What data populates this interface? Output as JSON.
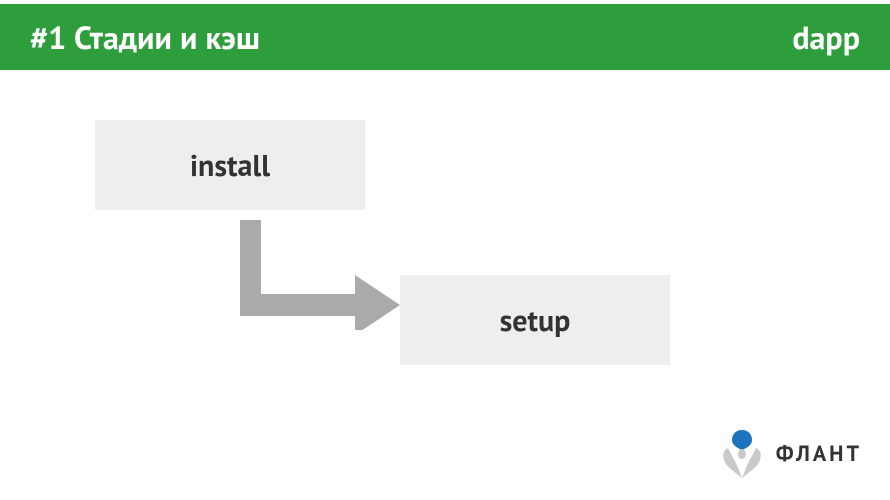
{
  "header": {
    "title": "#1 Стадии и кэш",
    "brand": "dapp"
  },
  "diagram": {
    "stages": [
      {
        "id": "install",
        "label": "install"
      },
      {
        "id": "setup",
        "label": "setup"
      }
    ]
  },
  "footer": {
    "company": "ФЛАНТ"
  },
  "colors": {
    "header_bg": "#2e9e3d",
    "box_bg": "#eeeeee",
    "arrow": "#aaaaaa",
    "logo_blue": "#1e73be",
    "logo_gray": "#c9c9c9"
  }
}
